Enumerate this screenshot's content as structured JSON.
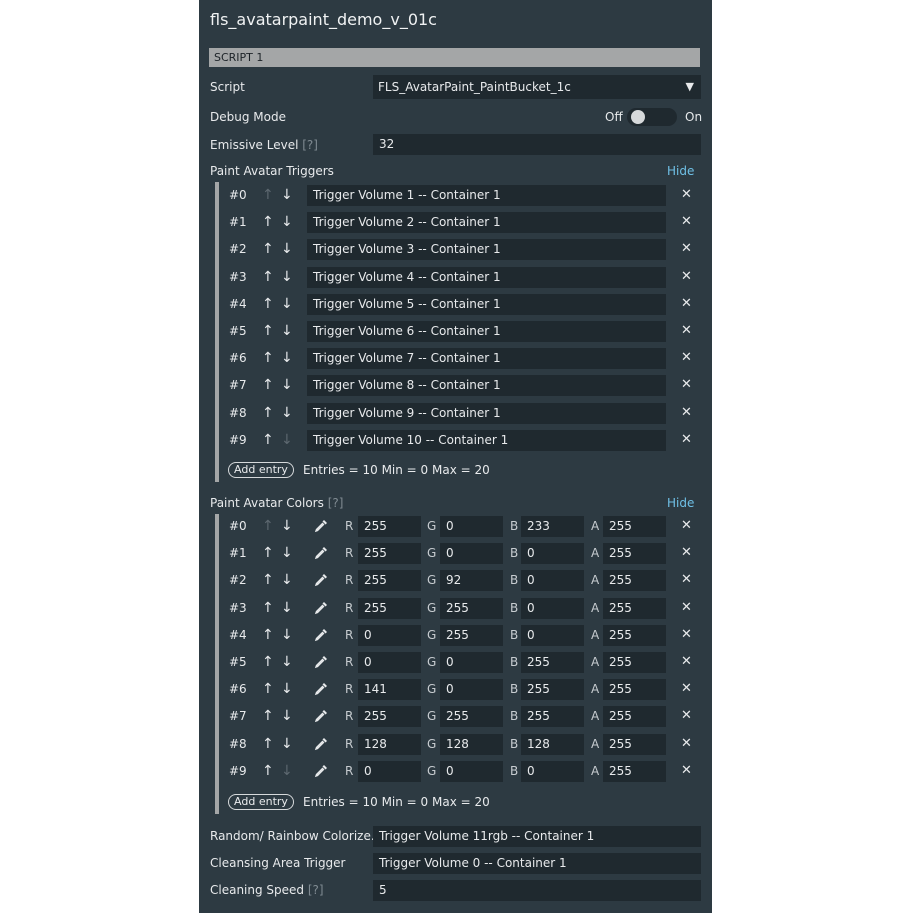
{
  "panel": {
    "title": "fls_avatarpaint_demo_v_01c",
    "script_header": "SCRIPT 1",
    "script_label": "Script",
    "script_value": "FLS_AvatarPaint_PaintBucket_1c",
    "debug_label": "Debug Mode",
    "debug_off": "Off",
    "debug_on": "On",
    "debug_value": "Off",
    "emissive_label": "Emissive Level",
    "emissive_hint": "[?]",
    "emissive_value": "32"
  },
  "triggers": {
    "label": "Paint Avatar Triggers",
    "hide": "Hide",
    "add_label": "Add entry",
    "stats": "Entries = 10   Min = 0   Max = 20",
    "rows": [
      {
        "idx": "#0",
        "value": "Trigger Volume 1 -- Container 1"
      },
      {
        "idx": "#1",
        "value": "Trigger Volume 2 -- Container 1"
      },
      {
        "idx": "#2",
        "value": "Trigger Volume 3 -- Container 1"
      },
      {
        "idx": "#3",
        "value": "Trigger Volume 4 -- Container 1"
      },
      {
        "idx": "#4",
        "value": "Trigger Volume 5 -- Container 1"
      },
      {
        "idx": "#5",
        "value": "Trigger Volume 6 -- Container 1"
      },
      {
        "idx": "#6",
        "value": "Trigger Volume 7 -- Container 1"
      },
      {
        "idx": "#7",
        "value": "Trigger Volume 8 -- Container 1"
      },
      {
        "idx": "#8",
        "value": "Trigger Volume 9 -- Container 1"
      },
      {
        "idx": "#9",
        "value": "Trigger Volume 10 -- Container 1"
      }
    ]
  },
  "colors": {
    "label": "Paint Avatar Colors",
    "hint": "[?]",
    "hide": "Hide",
    "add_label": "Add entry",
    "stats": "Entries = 10   Min = 0   Max = 20",
    "channel_labels": {
      "r": "R",
      "g": "G",
      "b": "B",
      "a": "A"
    },
    "rows": [
      {
        "idx": "#0",
        "r": "255",
        "g": "0",
        "b": "233",
        "a": "255"
      },
      {
        "idx": "#1",
        "r": "255",
        "g": "0",
        "b": "0",
        "a": "255"
      },
      {
        "idx": "#2",
        "r": "255",
        "g": "92",
        "b": "0",
        "a": "255"
      },
      {
        "idx": "#3",
        "r": "255",
        "g": "255",
        "b": "0",
        "a": "255"
      },
      {
        "idx": "#4",
        "r": "0",
        "g": "255",
        "b": "0",
        "a": "255"
      },
      {
        "idx": "#5",
        "r": "0",
        "g": "0",
        "b": "255",
        "a": "255"
      },
      {
        "idx": "#6",
        "r": "141",
        "g": "0",
        "b": "255",
        "a": "255"
      },
      {
        "idx": "#7",
        "r": "255",
        "g": "255",
        "b": "255",
        "a": "255"
      },
      {
        "idx": "#8",
        "r": "128",
        "g": "128",
        "b": "128",
        "a": "255"
      },
      {
        "idx": "#9",
        "r": "0",
        "g": "0",
        "b": "0",
        "a": "255"
      }
    ]
  },
  "bottom": {
    "rainbow_label": "Random/ Rainbow Colorize...",
    "rainbow_value": "Trigger Volume 11rgb -- Container 1",
    "cleansing_label": "Cleansing Area Trigger",
    "cleansing_value": "Trigger Volume 0 -- Container 1",
    "speed_label": "Cleaning Speed",
    "speed_hint": "[?]",
    "speed_value": "5"
  },
  "icons": {
    "up": "arrow-up-icon",
    "down": "arrow-down-icon",
    "remove": "close-icon",
    "picker": "eyedropper-icon",
    "dropdown": "chevron-down-icon"
  },
  "theme": {
    "panel_bg": "#2d3a42",
    "field_bg": "#1f292f",
    "link": "#6fc0e6",
    "header_bar": "#a4a6a7"
  }
}
